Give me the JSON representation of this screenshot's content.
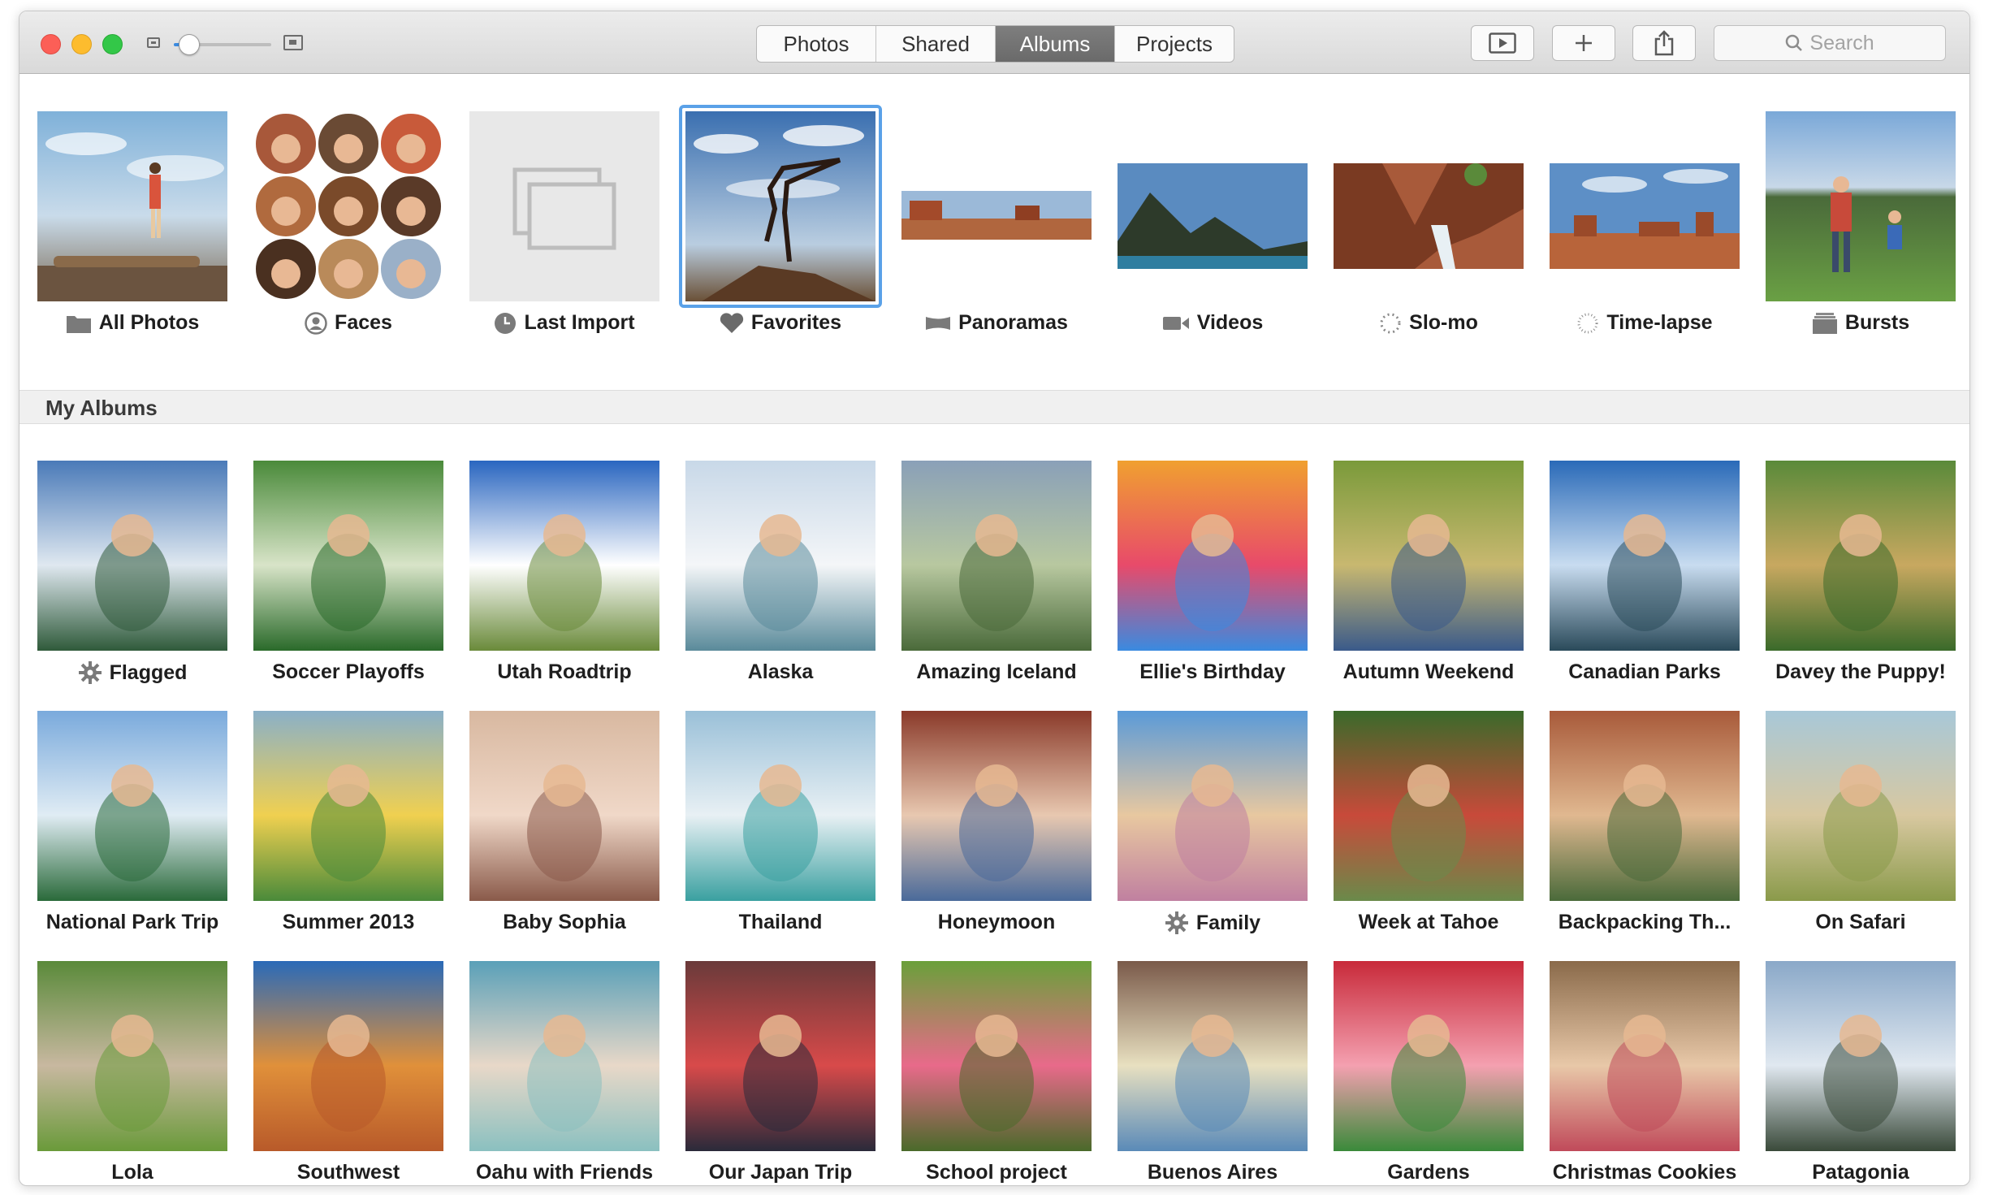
{
  "toolbar": {
    "tabs": [
      {
        "label": "Photos",
        "active": false
      },
      {
        "label": "Shared",
        "active": false
      },
      {
        "label": "Albums",
        "active": true
      },
      {
        "label": "Projects",
        "active": false
      }
    ],
    "zoom_level": 0.15,
    "icons": [
      "slideshow-icon",
      "add-icon",
      "share-icon"
    ],
    "search_placeholder": "Search"
  },
  "smart_albums": [
    {
      "label": "All Photos",
      "icon": "folder-icon"
    },
    {
      "label": "Faces",
      "icon": "person-icon"
    },
    {
      "label": "Last Import",
      "icon": "clock-icon"
    },
    {
      "label": "Favorites",
      "icon": "heart-icon",
      "selected": true
    },
    {
      "label": "Panoramas",
      "icon": "panorama-icon"
    },
    {
      "label": "Videos",
      "icon": "video-camera-icon"
    },
    {
      "label": "Slo-mo",
      "icon": "slomo-icon"
    },
    {
      "label": "Time-lapse",
      "icon": "timelapse-icon"
    },
    {
      "label": "Bursts",
      "icon": "bursts-icon"
    }
  ],
  "section_title": "My Albums",
  "my_albums": [
    {
      "label": "Flagged",
      "icon": "gear-icon"
    },
    {
      "label": "Soccer Playoffs"
    },
    {
      "label": "Utah Roadtrip"
    },
    {
      "label": "Alaska"
    },
    {
      "label": "Amazing Iceland"
    },
    {
      "label": "Ellie's Birthday"
    },
    {
      "label": "Autumn Weekend"
    },
    {
      "label": "Canadian Parks"
    },
    {
      "label": "Davey the Puppy!"
    },
    {
      "label": "National Park Trip"
    },
    {
      "label": "Summer 2013"
    },
    {
      "label": "Baby Sophia"
    },
    {
      "label": "Thailand"
    },
    {
      "label": "Honeymoon"
    },
    {
      "label": "Family",
      "icon": "gear-icon"
    },
    {
      "label": "Week at Tahoe"
    },
    {
      "label": "Backpacking Th..."
    },
    {
      "label": "On Safari"
    },
    {
      "label": "Lola"
    },
    {
      "label": "Southwest"
    },
    {
      "label": "Oahu with Friends"
    },
    {
      "label": "Our Japan Trip"
    },
    {
      "label": "School project"
    },
    {
      "label": "Buenos Aires"
    },
    {
      "label": "Gardens"
    },
    {
      "label": "Christmas Cookies"
    },
    {
      "label": "Patagonia"
    }
  ],
  "colors": {
    "accent": "#3b8be0",
    "selection": "#5aa1e8",
    "active_tab": "#737373"
  }
}
